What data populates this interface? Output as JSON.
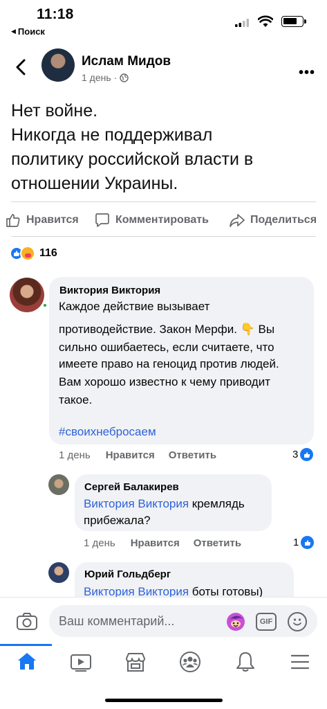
{
  "status_bar": {
    "time": "11:18",
    "back_label": "Поиск"
  },
  "post": {
    "author": "Ислам Мидов",
    "meta": "1 день",
    "text_lines": [
      "Нет войне.",
      "Никогда не поддерживал",
      "политику российской власти в",
      "отношении Украины."
    ]
  },
  "actions": {
    "like": "Нравится",
    "comment": "Комментировать",
    "share": "Поделиться"
  },
  "reactions": {
    "count": "116"
  },
  "comments": [
    {
      "author": "Виктория Виктория",
      "lines": [
        "Каждое действие вызывает",
        "противодействие. Закон Мерфи. 👇 Вы",
        "сильно ошибаетесь, если считаете, что",
        "имеете право на геноцид против людей.",
        "Вам хорошо известно к чему приводит",
        "такое."
      ],
      "hashtag": "#своихнебросаем",
      "time": "1 день",
      "like": "Нравится",
      "reply": "Ответить",
      "likes": "3"
    },
    {
      "author": "Сергей Балакирев",
      "mention": "Виктория Виктория",
      "text_after": " кремлядь",
      "text_line2": "прибежала?",
      "time": "1 день",
      "like": "Нравится",
      "reply": "Ответить",
      "likes": "1"
    },
    {
      "author": "Юрий Гольдберг",
      "mention": "Виктория Виктория",
      "text_after": " боты готовы)"
    }
  ],
  "composer": {
    "placeholder": "Ваш комментарий...",
    "gif_label": "GIF"
  },
  "tabs": [
    "home",
    "video",
    "marketplace",
    "groups",
    "notifications",
    "menu"
  ],
  "colors": {
    "accent": "#1877f2",
    "link": "#2f62d9",
    "bubble": "#f0f2f5",
    "secondary": "#65676b"
  }
}
